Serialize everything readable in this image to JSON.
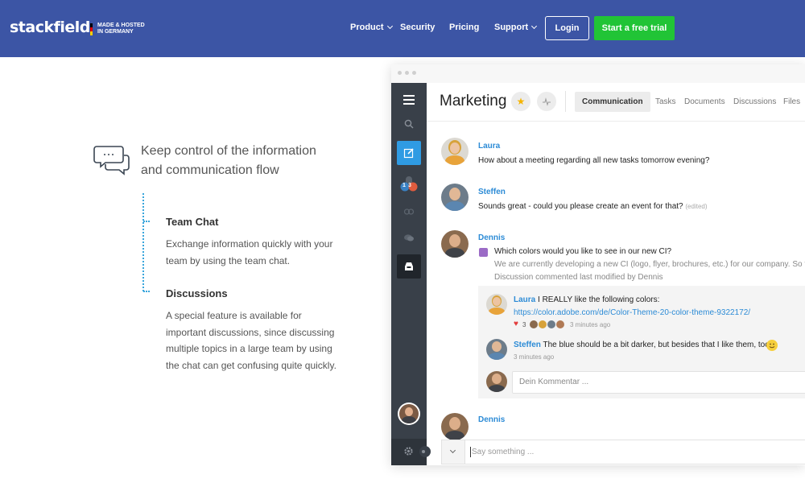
{
  "header": {
    "logo": "stackfield",
    "tagline_line1": "MADE & HOSTED",
    "tagline_line2": "IN GERMANY",
    "nav": [
      "Product",
      "Security",
      "Pricing",
      "Support"
    ],
    "login": "Login",
    "trial": "Start a free trial",
    "colors": {
      "bar": "#3c55a5",
      "trial": "#21c436"
    }
  },
  "intro": {
    "headline_line1": "Keep control of the information",
    "headline_line2": "and communication flow",
    "features": [
      {
        "title": "Team Chat",
        "text_lines": [
          "Exchange information quickly with your",
          "team by using the team chat."
        ]
      },
      {
        "title": "Discussions",
        "text_lines": [
          "A special feature is available for",
          "important discussions, since discussing",
          "multiple topics in a large team by using",
          "the chat can get confusing quite quickly."
        ]
      }
    ]
  },
  "app": {
    "sidebar": {
      "icons": [
        "menu-icon",
        "search-icon",
        "compose-icon",
        "notifications-icon",
        "link-icon",
        "chat-icon",
        "inbox-icon",
        "settings-icon"
      ],
      "badge1": "1",
      "badge2": "3"
    },
    "room_title": "Marketing",
    "tabs": [
      "Communication",
      "Tasks",
      "Documents",
      "Discussions",
      "Files"
    ],
    "messages": [
      {
        "author": "Laura",
        "text": "How about a meeting regarding all new tasks tomorrow evening?"
      },
      {
        "author": "Steffen",
        "text": "Sounds great - could you please create an event for that?",
        "edited": "(edited)"
      },
      {
        "author": "Dennis",
        "text": "Which colors would you like to see in our new CI?",
        "sub1": "We are currently developing a new CI (logo, flyer, brochures, etc.) for our company. So far",
        "sub2": "Discussion commented last modified by Dennis"
      },
      {
        "author": "Dennis"
      }
    ],
    "thread": {
      "reply1_author": "Laura",
      "reply1_text": "I REALLY like the following colors:",
      "reply1_link": "https://color.adobe.com/de/Color-Theme-20-color-theme-9322172/",
      "reply1_likes": "3",
      "reply1_time": "3 minutes ago",
      "reply2_author": "Steffen",
      "reply2_text": "The blue should be a bit darker, but besides that I like them, too!",
      "reply2_time": "3 minutes ago",
      "comment_placeholder": "Dein Kommentar ..."
    },
    "composer_placeholder": "Say something ..."
  }
}
